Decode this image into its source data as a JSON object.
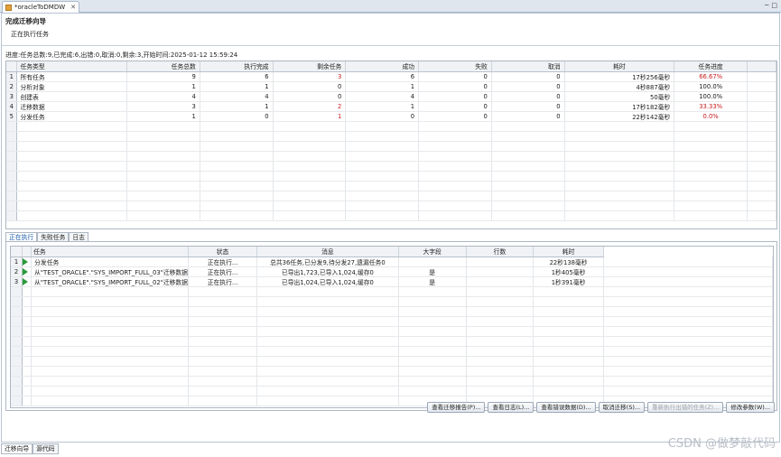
{
  "editor": {
    "tab_label": "*oracleToDMDW",
    "close": "✕"
  },
  "window_tools": [
    "─",
    "□"
  ],
  "banner": {
    "title": "完成迁移向导",
    "subtitle": "正在执行任务"
  },
  "progress_text": "进度:任务总数:9,已完成:6,出错:0,取消:0,剩余:3,开始时间:2025-01-12 15:59:24",
  "top_table": {
    "headers": [
      "任务类型",
      "任务总数",
      "执行完成",
      "剩余任务",
      "成功",
      "失败",
      "取消",
      "耗时",
      "任务进度"
    ],
    "rows": [
      {
        "n": "1",
        "type": "所有任务",
        "total": "9",
        "done": "6",
        "remain": "3",
        "ok": "6",
        "fail": "0",
        "cancel": "0",
        "time": "17秒256毫秒",
        "progress": "66.67%"
      },
      {
        "n": "2",
        "type": "分析对象",
        "total": "1",
        "done": "1",
        "remain": "0",
        "ok": "1",
        "fail": "0",
        "cancel": "0",
        "time": "4秒887毫秒",
        "progress": "100.0%"
      },
      {
        "n": "3",
        "type": "创建表",
        "total": "4",
        "done": "4",
        "remain": "0",
        "ok": "4",
        "fail": "0",
        "cancel": "0",
        "time": "50毫秒",
        "progress": "100.0%"
      },
      {
        "n": "4",
        "type": "迁移数据",
        "total": "3",
        "done": "1",
        "remain": "2",
        "ok": "1",
        "fail": "0",
        "cancel": "0",
        "time": "17秒182毫秒",
        "progress": "33.33%"
      },
      {
        "n": "5",
        "type": "分发任务",
        "total": "1",
        "done": "0",
        "remain": "1",
        "ok": "0",
        "fail": "0",
        "cancel": "0",
        "time": "22秒142毫秒",
        "progress": "0.0%"
      }
    ]
  },
  "sub_tabs": [
    "正在执行",
    "失败任务",
    "日志"
  ],
  "bottom_table": {
    "headers": [
      "任务",
      "状态",
      "消息",
      "大字段",
      "行数",
      "耗时"
    ],
    "rows": [
      {
        "n": "1",
        "task": "分发任务",
        "status": "正在执行...",
        "msg": "总共36任务,已分发9,待分发27,遗漏任务0",
        "lob": "",
        "rows": "",
        "time": "22秒138毫秒"
      },
      {
        "n": "2",
        "task": "从\"TEST_ORACLE\".\"SYS_IMPORT_FULL_03\"迁移数据",
        "status": "正在执行...",
        "msg": "已导出1,723,已导入1,024,缓存0",
        "lob": "是",
        "rows": "",
        "time": "1秒405毫秒"
      },
      {
        "n": "3",
        "task": "从\"TEST_ORACLE\".\"SYS_IMPORT_FULL_02\"迁移数据",
        "status": "正在执行...",
        "msg": "已导出1,024,已导入1,024,缓存0",
        "lob": "是",
        "rows": "",
        "time": "1秒391毫秒"
      }
    ]
  },
  "buttons": [
    "查看迁移报告(P)...",
    "查看日志(L)...",
    "查看错误数据(D)...",
    "取消迁移(S)...",
    "重新执行出错的任务(Z)...",
    "修改参数(W)..."
  ],
  "bottom_tabs": [
    "迁移向导",
    "源代码"
  ],
  "watermark": "CSDN @做梦敲代码",
  "colors": {
    "accent_red": "#c82020",
    "play_green": "#2a9a3a"
  }
}
